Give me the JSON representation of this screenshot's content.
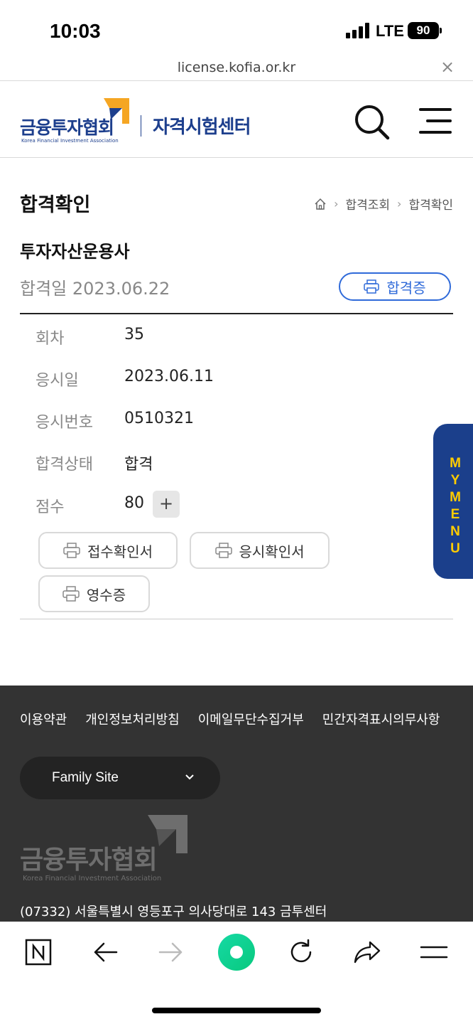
{
  "status_bar": {
    "time": "10:03",
    "network": "LTE",
    "battery": "90"
  },
  "browser": {
    "url": "license.kofia.or.kr",
    "close_glyph": "×"
  },
  "header": {
    "logo_text": "금융투자협회",
    "logo_sub": "Korea Financial Investment Association",
    "center_title": "자격시험센터",
    "search_icon": "search-icon",
    "menu_icon": "hamburger-icon"
  },
  "page": {
    "title": "합격확인",
    "breadcrumb": [
      "합격조회",
      "합격확인"
    ]
  },
  "result": {
    "exam_name": "투자자산운용사",
    "pass_date_label": "합격일",
    "pass_date": "2023.06.22",
    "certificate_button": "합격증",
    "rows": [
      {
        "label": "회차",
        "value": "35"
      },
      {
        "label": "응시일",
        "value": "2023.06.11"
      },
      {
        "label": "응시번호",
        "value": "0510321"
      },
      {
        "label": "합격상태",
        "value": "합격"
      },
      {
        "label": "점수",
        "value": "80"
      }
    ],
    "score_expand": "+",
    "doc_buttons": [
      "접수확인서",
      "응시확인서",
      "영수증"
    ]
  },
  "mymenu": {
    "letters": [
      "M",
      "Y",
      "M",
      "E",
      "N",
      "U"
    ]
  },
  "footer": {
    "links": [
      "이용약관",
      "개인정보처리방침",
      "이메일무단수집거부",
      "민간자격표시의무사항"
    ],
    "family_site": "Family Site",
    "logo_text": "금융투자협회",
    "logo_sub": "Korea Financial Investment Association",
    "address": "(07332) 서울특별시 영등포구 의사당대로 143 금투센터"
  },
  "colors": {
    "brand": "#1d3f8b",
    "accent": "#2f6ad9",
    "mymenu_text": "#ffcc00",
    "footer_bg": "#333333"
  }
}
